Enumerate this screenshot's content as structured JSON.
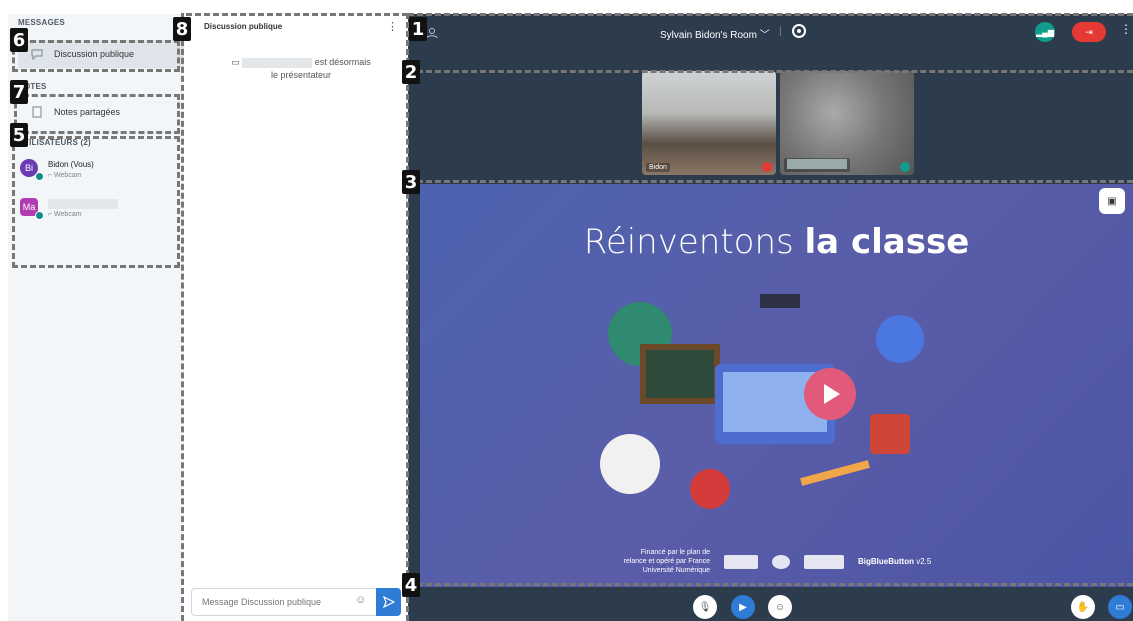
{
  "sidebar": {
    "messages_title": "MESSAGES",
    "chat_item": "Discussion publique",
    "notes_title": "NOTES",
    "notes_item": "Notes partagées",
    "users_title": "UTILISATEURS (2)",
    "users": [
      {
        "initials": "Bi",
        "name": "Bidon (Vous)",
        "sub": "Webcam",
        "color": "#6a3bb3"
      },
      {
        "initials": "Ma",
        "name": "",
        "sub": "Webcam",
        "color": "#b03cb0"
      }
    ]
  },
  "chat": {
    "title": "Discussion publique",
    "system_message_a": "est désormais",
    "system_message_b": "le présentateur",
    "placeholder": "Message Discussion publique"
  },
  "topbar": {
    "room_name": "Sylvain Bidon's Room"
  },
  "webcams": [
    {
      "name": "Bidon"
    },
    {
      "name": ""
    }
  ],
  "presentation": {
    "title_light": "Réinventons ",
    "title_bold": "la classe",
    "funded": "Financé par le plan de relance et opéré par France Université Numérique",
    "brand": "BigBlueButton",
    "version": "v2.5"
  },
  "annotations": [
    "1",
    "2",
    "3",
    "4",
    "5",
    "6",
    "7",
    "8"
  ],
  "colors": {
    "accent": "#2f7cd6",
    "leave": "#e53935",
    "connection": "#0f9d8e",
    "main_bg": "#2c3c4c"
  }
}
